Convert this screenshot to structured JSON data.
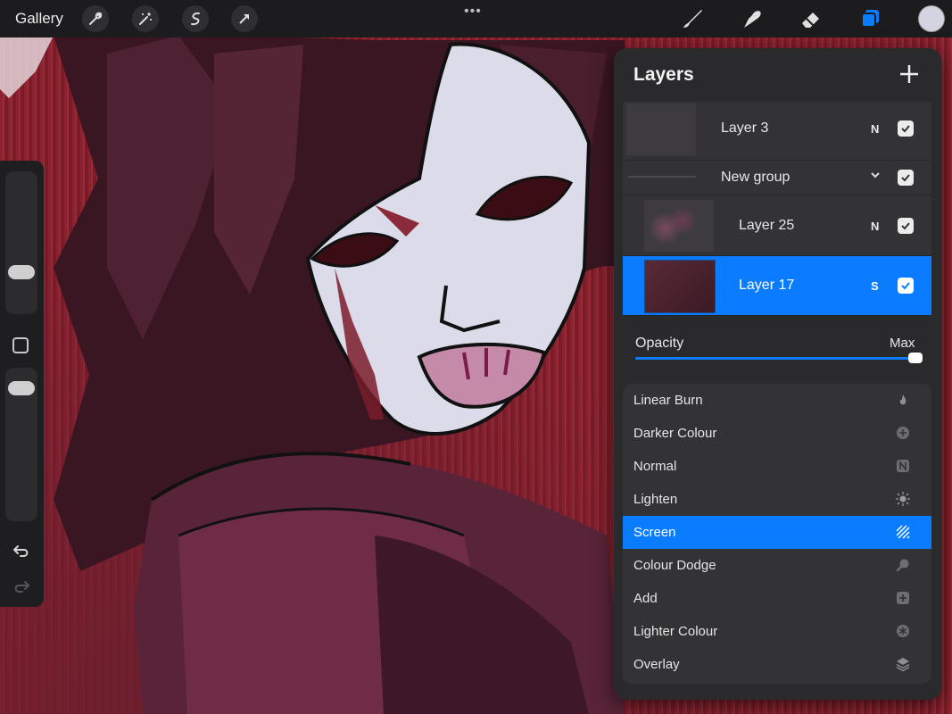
{
  "topbar": {
    "gallery_label": "Gallery",
    "left_tools": [
      "wrench-icon",
      "magic-wand-icon",
      "selection-icon",
      "transform-arrow-icon"
    ],
    "more_dots": "•••",
    "right_tools": [
      "brush-icon",
      "smudge-icon",
      "eraser-icon",
      "layers-icon"
    ],
    "current_color": "#d4d3e0"
  },
  "layers": {
    "title": "Layers",
    "rows": [
      {
        "name": "Layer 3",
        "mode": "N",
        "visible": true
      },
      {
        "name": "New group",
        "mode": "",
        "visible": true
      },
      {
        "name": "Layer 25",
        "mode": "N",
        "visible": true
      },
      {
        "name": "Layer 17",
        "mode": "S",
        "visible": true
      }
    ],
    "opacity_label": "Opacity",
    "opacity_value": "Max",
    "opacity_level": 1.0,
    "accent_color": "#0a7cff"
  },
  "blend_modes": [
    {
      "label": "Linear Burn",
      "icon": "flame-icon"
    },
    {
      "label": "Darker Colour",
      "icon": "plus-circle-icon"
    },
    {
      "label": "Normal",
      "icon": "n-square-icon"
    },
    {
      "label": "Lighten",
      "icon": "sun-burst-icon"
    },
    {
      "label": "Screen",
      "icon": "hatch-icon",
      "selected": true
    },
    {
      "label": "Colour Dodge",
      "icon": "magnifier-icon"
    },
    {
      "label": "Add",
      "icon": "plus-square-icon"
    },
    {
      "label": "Lighter Colour",
      "icon": "asterisk-circle-icon"
    },
    {
      "label": "Overlay",
      "icon": "stack-icon"
    }
  ]
}
